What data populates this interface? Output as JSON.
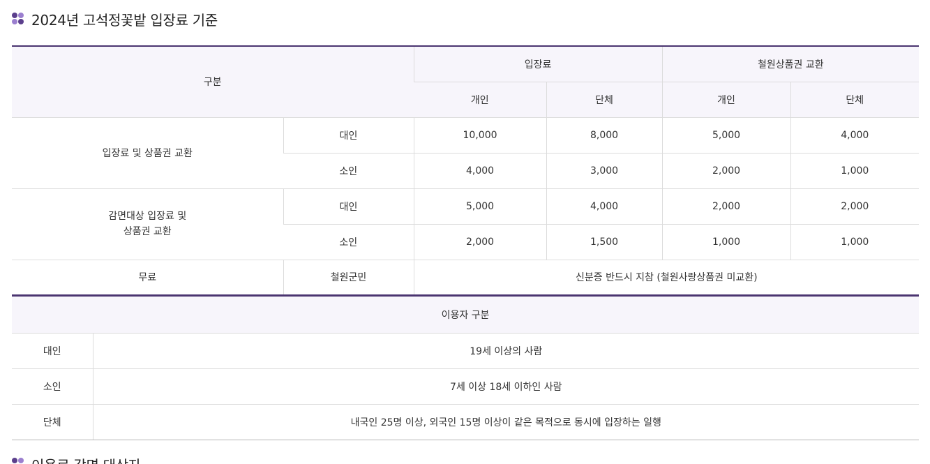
{
  "section1": {
    "title": "2024년 고석정꽃밭 입장료 기준"
  },
  "fee_table": {
    "header": {
      "category": "구분",
      "admission": "입장료",
      "voucher": "철원상품권 교환",
      "individual": "개인",
      "group": "단체"
    },
    "rows": [
      {
        "group": "입장료 및 상품권 교환",
        "items": [
          {
            "type": "대인",
            "admission_individual": "10,000",
            "admission_group": "8,000",
            "voucher_individual": "5,000",
            "voucher_group": "4,000"
          },
          {
            "type": "소인",
            "admission_individual": "4,000",
            "admission_group": "3,000",
            "voucher_individual": "2,000",
            "voucher_group": "1,000"
          }
        ]
      },
      {
        "group_line1": "감면대상 입장료 및",
        "group_line2": "상품권 교환",
        "items": [
          {
            "type": "대인",
            "admission_individual": "5,000",
            "admission_group": "4,000",
            "voucher_individual": "2,000",
            "voucher_group": "2,000"
          },
          {
            "type": "소인",
            "admission_individual": "2,000",
            "admission_group": "1,500",
            "voucher_individual": "1,000",
            "voucher_group": "1,000"
          }
        ]
      }
    ],
    "free": {
      "label": "무료",
      "type": "철원군민",
      "note": "신분증 반드시 지참 (철원사랑상품권 미교환)"
    }
  },
  "user_table": {
    "title": "이용자 구분",
    "rows": [
      {
        "label": "대인",
        "desc": "19세 이상의 사람"
      },
      {
        "label": "소인",
        "desc": "7세 이상 18세 이하인 사람"
      },
      {
        "label": "단체",
        "desc": "내국인 25명 이상, 외국인 15명 이상이 같은 목적으로 동시에 입장하는 일행"
      }
    ]
  },
  "section2": {
    "title": "이용료 감면 대상자"
  }
}
